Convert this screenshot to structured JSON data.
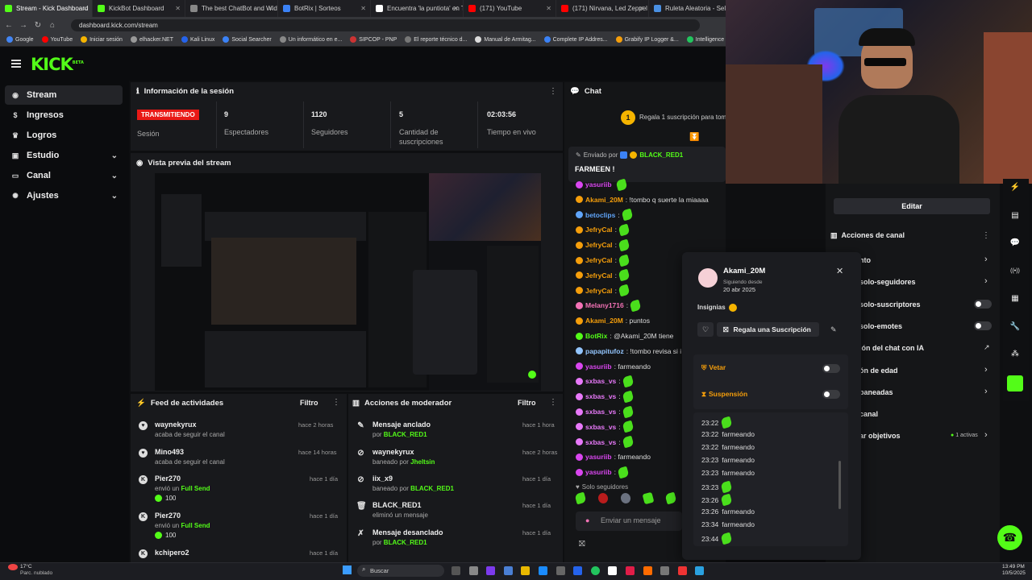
{
  "browser": {
    "tabs": [
      {
        "title": "Stream - Kick Dashboard",
        "color": "#53fc18",
        "active": true
      },
      {
        "title": "KickBot Dashboard",
        "color": "#53fc18"
      },
      {
        "title": "The best ChatBot and Widget",
        "color": "#888888"
      },
      {
        "title": "BotRix | Sorteos",
        "color": "#3b82f6"
      },
      {
        "title": "Encuentra 'la puntiota' en Tik",
        "color": "#ffffff"
      },
      {
        "title": "(171) YouTube",
        "color": "#ff0000"
      },
      {
        "title": "(171) Nirvana, Led Zeppel",
        "color": "#ff0000"
      },
      {
        "title": "Ruleta Aleatoria - Selec",
        "color": "#4a90e2"
      }
    ],
    "url": "dashboard.kick.com/stream",
    "bookmarks": [
      "Google",
      "YouTube",
      "Iniciar sesión",
      "elhacker.NET",
      "Kali Linux",
      "Social Searcher",
      "Un informático en e...",
      "SIPCOP - PNP",
      "El reporte técnico d...",
      "Manual de Armitag...",
      "Complete IP Addres...",
      "Grabify IP Logger &...",
      "Intelligence X",
      "Online investigation..."
    ]
  },
  "app": {
    "logo": "KICK",
    "logo_sup": "BETA"
  },
  "sidebar": {
    "items": [
      {
        "label": "Stream",
        "icon": "stream-icon"
      },
      {
        "label": "Ingresos",
        "icon": "dollar-icon"
      },
      {
        "label": "Logros",
        "icon": "trophy-icon"
      },
      {
        "label": "Estudio",
        "icon": "studio-icon"
      },
      {
        "label": "Canal",
        "icon": "channel-icon"
      },
      {
        "label": "Ajustes",
        "icon": "gear-icon"
      }
    ]
  },
  "session": {
    "title": "Información de la sesión",
    "badge": "TRANSMITIENDO",
    "badge_label": "Sesión",
    "stats": [
      {
        "value": "9",
        "label": "Espectadores"
      },
      {
        "value": "1120",
        "label": "Seguidores"
      },
      {
        "value": "5",
        "label": "Cantidad de suscripciones"
      },
      {
        "value": "02:03:56",
        "label": "Tiempo en vivo"
      }
    ]
  },
  "preview": {
    "title": "Vista previa del stream"
  },
  "feed": {
    "title": "Feed de actividades",
    "filter": "Filtro",
    "items": [
      {
        "name": "waynekyrux",
        "sub": "acaba de seguir el canal",
        "time": "hace 2 horas"
      },
      {
        "name": "Mino493",
        "sub": "acaba de seguir el canal",
        "time": "hace 14 horas"
      },
      {
        "name": "Pier270",
        "sub": "envió un",
        "gift": "Full Send",
        "amount": "100",
        "time": "hace 1 día"
      },
      {
        "name": "Pier270",
        "sub": "envió un",
        "gift": "Full Send",
        "amount": "100",
        "time": "hace 1 día"
      },
      {
        "name": "kchipero2",
        "time": "hace 1 día"
      }
    ]
  },
  "mod": {
    "title": "Acciones de moderador",
    "filter": "Filtro",
    "items": [
      {
        "name": "Mensaje anclado",
        "by": "por",
        "who": "BLACK_RED1",
        "time": "hace 1 hora"
      },
      {
        "name": "waynekyrux",
        "by": "baneado por",
        "who": "Jheltsin",
        "time": "hace 2 horas"
      },
      {
        "name": "iix_x9",
        "by": "baneado por",
        "who": "BLACK_RED1",
        "time": "hace 1 día"
      },
      {
        "name": "BLACK_RED1",
        "by": "eliminó un mensaje",
        "who": "",
        "time": "hace 1 día"
      },
      {
        "name": "Mensaje desanclado",
        "by": "por",
        "who": "BLACK_RED1",
        "time": "hace 1 día"
      }
    ]
  },
  "chat": {
    "title": "Chat",
    "gift_banner": "Regala 1 suscripción para tom",
    "gift_count": "1",
    "pinned_by_label": "Enviado por",
    "pinned_by": "BLACK_RED1",
    "pinned_text": "FARMEEN !",
    "messages": [
      {
        "user": "yasuriib",
        "text": "",
        "color": "#d946ef"
      },
      {
        "user": "Akami_20M",
        "text": ": !tombo q suerte la miaaaa",
        "color": "#f59e0b"
      },
      {
        "user": "betoclips",
        "text": ":",
        "color": "#60a5fa"
      },
      {
        "user": "JefryCal",
        "text": ":",
        "color": "#f59e0b"
      },
      {
        "user": "JefryCal",
        "text": ":",
        "color": "#f59e0b"
      },
      {
        "user": "JefryCal",
        "text": ":",
        "color": "#f59e0b"
      },
      {
        "user": "JefryCal",
        "text": ":",
        "color": "#f59e0b"
      },
      {
        "user": "JefryCal",
        "text": ":",
        "color": "#f59e0b"
      },
      {
        "user": "Melany1716",
        "text": ":",
        "color": "#f472b6"
      },
      {
        "user": "Akami_20M",
        "text": ": puntos",
        "color": "#f59e0b"
      },
      {
        "user": "BotRix",
        "text": ": @Akami_20M tiene",
        "color": "#53fc18"
      },
      {
        "user": "papapitufoz",
        "text": ": !tombo revisa si i",
        "color": "#93c5fd"
      },
      {
        "user": "yasuriib",
        "text": ": farmeando",
        "color": "#d946ef"
      },
      {
        "user": "sxbas_vs",
        "text": ":",
        "color": "#e879f9"
      },
      {
        "user": "sxbas_vs",
        "text": ":",
        "color": "#e879f9"
      },
      {
        "user": "sxbas_vs",
        "text": ":",
        "color": "#e879f9"
      },
      {
        "user": "sxbas_vs",
        "text": ":",
        "color": "#e879f9"
      },
      {
        "user": "sxbas_vs",
        "text": ":",
        "color": "#e879f9"
      },
      {
        "user": "yasuriib",
        "text": ": farmeando",
        "color": "#d946ef"
      },
      {
        "user": "yasuriib",
        "text": ":",
        "color": "#d946ef"
      }
    ],
    "followers_only": "Solo seguidores",
    "input_placeholder": "Enviar un mensaje"
  },
  "user_card": {
    "name": "Akami_20M",
    "following_label": "Siguiendo desde",
    "following_date": "20 abr 2025",
    "badges_label": "Insignias",
    "gift_button": "Regala una Suscripción",
    "veto": "Vetar",
    "suspension": "Suspensión",
    "log": [
      {
        "time": "23:22",
        "text": ""
      },
      {
        "time": "23:22",
        "text": "farmeando"
      },
      {
        "time": "23:22",
        "text": "farmeando"
      },
      {
        "time": "23:23",
        "text": "farmeando"
      },
      {
        "time": "23:23",
        "text": "farmeando"
      },
      {
        "time": "23:23",
        "text": ""
      },
      {
        "time": "23:26",
        "text": ""
      },
      {
        "time": "23:26",
        "text": "farmeando"
      },
      {
        "time": "23:34",
        "text": "farmeando"
      },
      {
        "time": "23:44",
        "text": ""
      }
    ]
  },
  "channel_actions": {
    "edit": "Editar",
    "title": "Acciones de canal",
    "items": [
      {
        "label": "nto",
        "control": "chevron"
      },
      {
        "label": "solo-seguidores",
        "control": "chevron"
      },
      {
        "label": "solo-suscriptores",
        "control": "toggle"
      },
      {
        "label": "solo-emotes",
        "control": "toggle"
      },
      {
        "label": "ión del chat con IA",
        "control": "external"
      },
      {
        "label": "ón de edad",
        "control": "chevron"
      },
      {
        "label": "baneadas",
        "control": "chevron"
      },
      {
        "label": "canal",
        "control": ""
      },
      {
        "label": "ar objetivos",
        "control": "chevron",
        "extra": "1 activas"
      }
    ]
  },
  "taskbar": {
    "weather_temp": "17°C",
    "weather_desc": "Parc. nublado",
    "search": "Buscar",
    "time": "13:49 PM",
    "date": "10/5/2025"
  },
  "colors": {
    "accent": "#53fc18",
    "live": "#e91916",
    "panel": "#18191c",
    "bg": "#0e0f11"
  }
}
